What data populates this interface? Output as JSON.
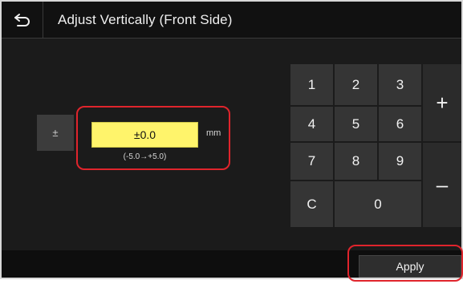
{
  "header": {
    "back_icon": "back-arrow-icon",
    "title": "Adjust Vertically (Front Side)"
  },
  "adjust": {
    "plus_minus_label": "±",
    "value": "±0.0",
    "unit": "mm",
    "range": "(-5.0→+5.0)"
  },
  "keypad": {
    "k1": "1",
    "k2": "2",
    "k3": "3",
    "k4": "4",
    "k5": "5",
    "k6": "6",
    "k7": "7",
    "k8": "8",
    "k9": "9",
    "clear": "C",
    "k0": "0",
    "plus": "+",
    "minus": "–"
  },
  "footer": {
    "apply_label": "Apply"
  },
  "colors": {
    "highlight": "#e0242c",
    "value_field": "#fff46b"
  }
}
